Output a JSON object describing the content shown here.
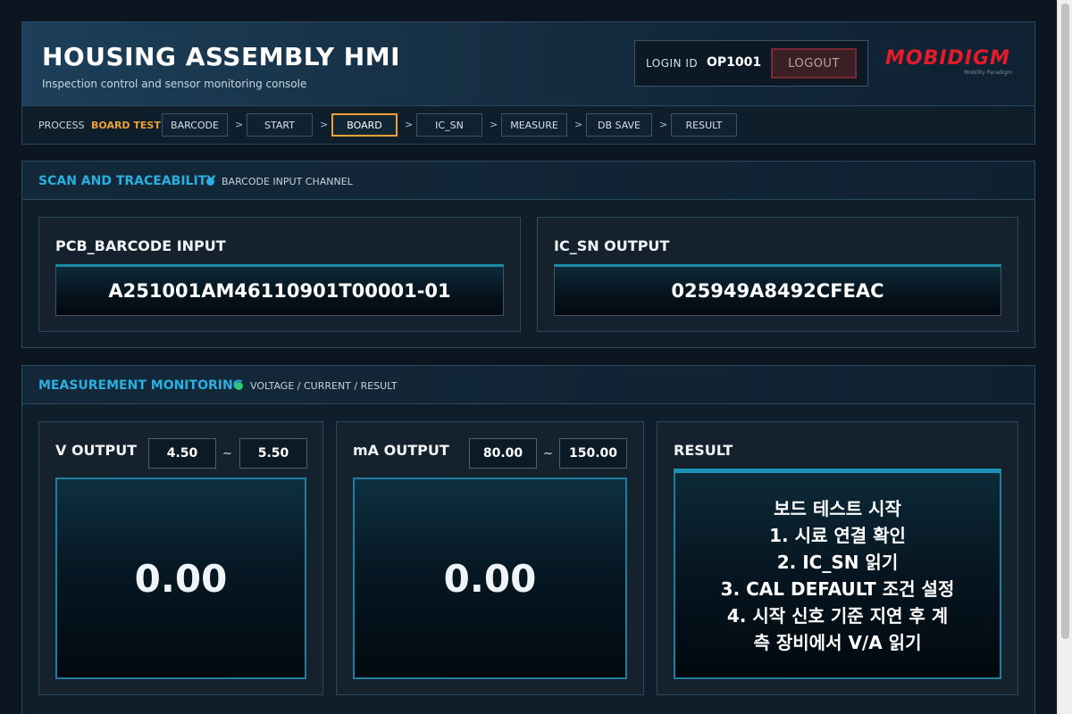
{
  "header": {
    "title": "HOUSING ASSEMBLY HMI",
    "subtitle": "Inspection control and sensor monitoring console",
    "login_label": "LOGIN ID",
    "login_id": "OP1001",
    "logout_label": "LOGOUT",
    "brand_wordmark": "MOBIDIGM",
    "brand_tagline": "Mobility Paradigm"
  },
  "process": {
    "label": "PROCESS",
    "current": "BOARD TEST",
    "separator": ">",
    "steps": [
      "BARCODE",
      "START",
      "BOARD",
      "IC_SN",
      "MEASURE",
      "DB SAVE",
      "RESULT"
    ],
    "active_step": "BOARD"
  },
  "scan": {
    "title": "SCAN AND TRACEABILITY",
    "subtitle": "BARCODE INPUT CHANNEL",
    "dot_color": "#2ab0e0",
    "pcb": {
      "label": "PCB_BARCODE INPUT",
      "value": "A251001AM46110901T00001-01"
    },
    "ic": {
      "label": "IC_SN OUTPUT",
      "value": "025949A8492CFEAC"
    }
  },
  "measure": {
    "title": "MEASUREMENT MONITORING",
    "subtitle": "VOLTAGE / CURRENT / RESULT",
    "dot_color": "#2ecc71",
    "range_separator": "~",
    "voltage": {
      "label": "V OUTPUT",
      "min": "4.50",
      "max": "5.50",
      "value": "0.00"
    },
    "current": {
      "label": "mA OUTPUT",
      "min": "80.00",
      "max": "150.00",
      "value": "0.00"
    },
    "result": {
      "label": "RESULT",
      "lines": [
        "보드 테스트 시작",
        "1. 시료 연결 확인",
        "2. IC_SN 읽기",
        "3. CAL DEFAULT 조건 설정",
        "4. 시작 신호 기준 지연 후 계",
        "측 장비에서 V/A 읽기"
      ]
    }
  }
}
